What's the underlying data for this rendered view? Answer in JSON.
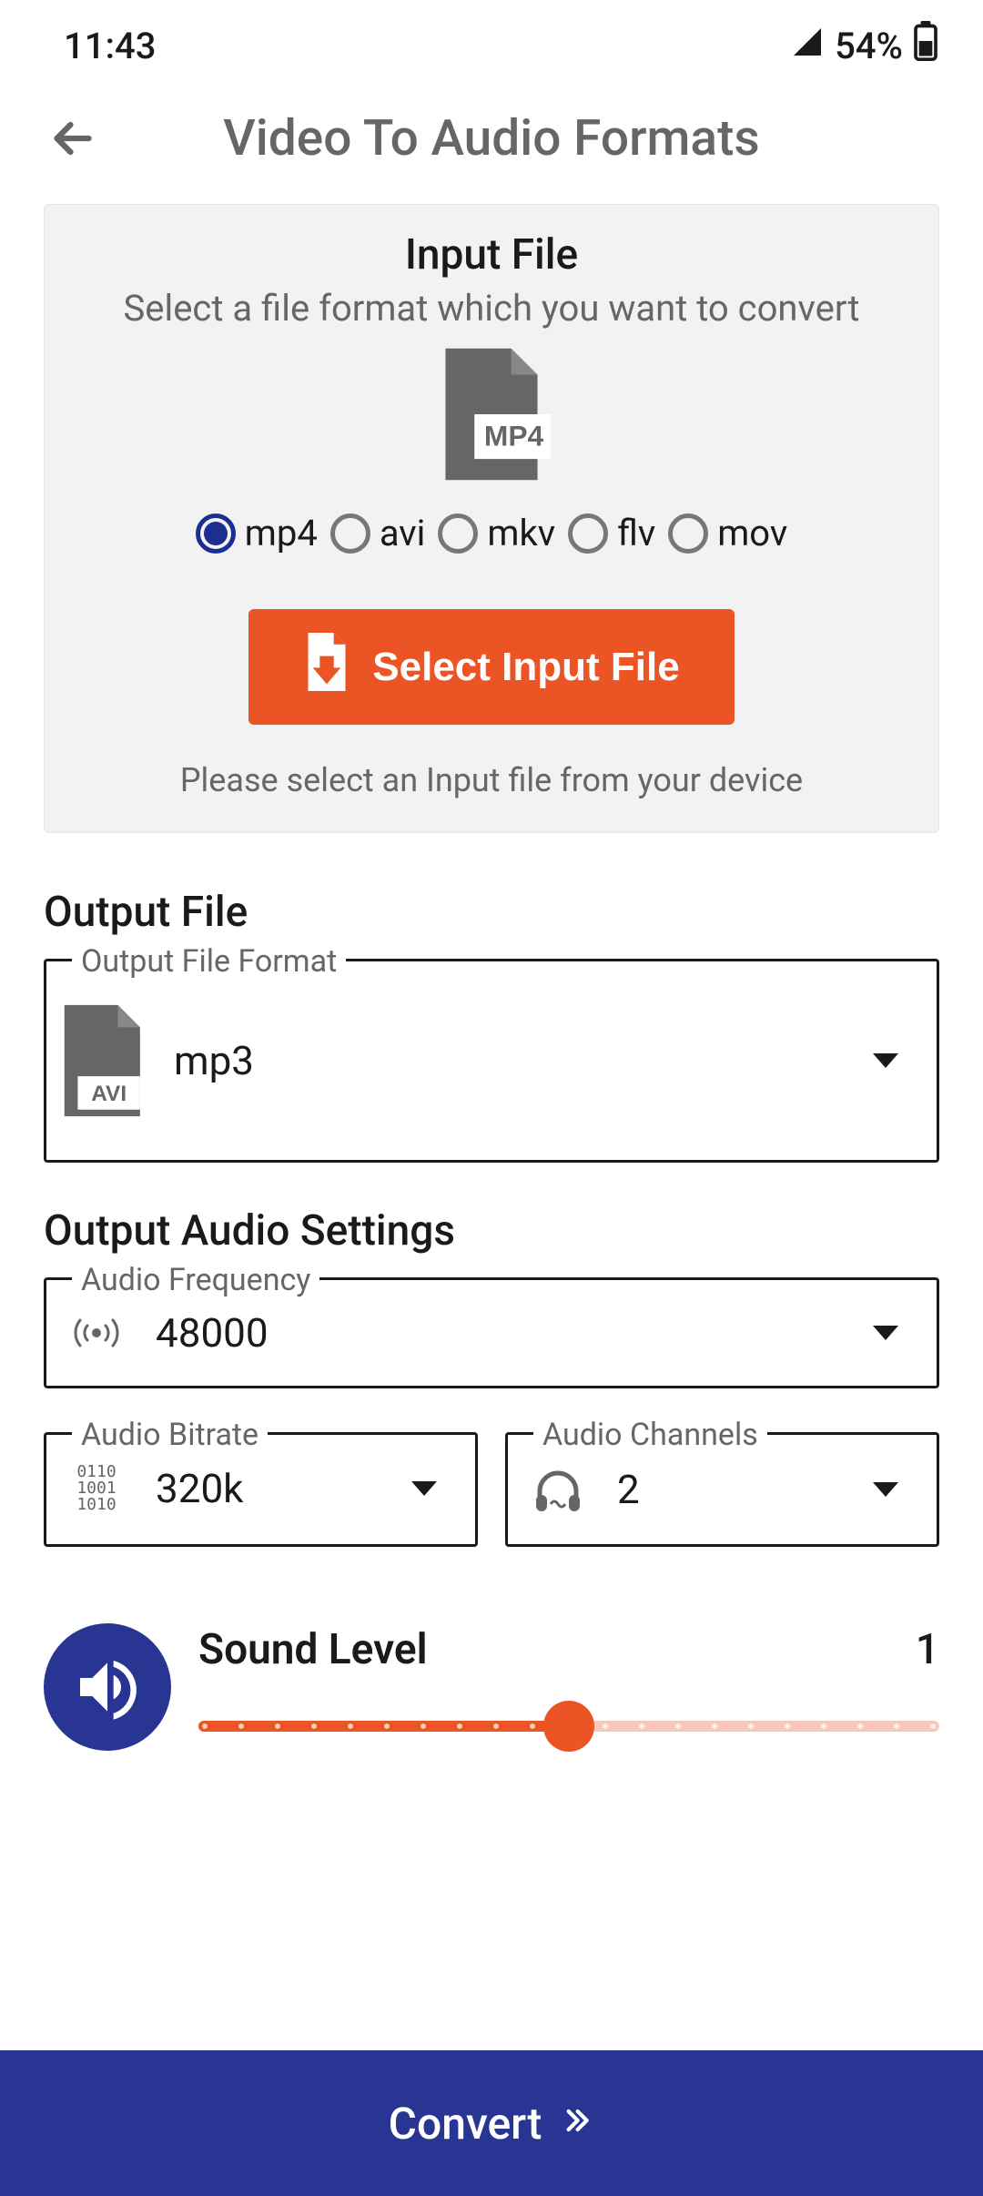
{
  "status": {
    "time": "11:43",
    "battery_pct": "54%"
  },
  "header": {
    "title": "Video To Audio Formats"
  },
  "input_card": {
    "title": "Input File",
    "subtitle": "Select a file format which you want to convert",
    "file_badge": "MP4",
    "formats": [
      "mp4",
      "avi",
      "mkv",
      "flv",
      "mov"
    ],
    "selected_format": "mp4",
    "button_label": "Select Input File",
    "hint": "Please select an Input file from your device"
  },
  "output": {
    "section_title": "Output File",
    "format": {
      "legend": "Output File Format",
      "icon_badge": "AVI",
      "value": "mp3"
    }
  },
  "audio_settings": {
    "section_title": "Output Audio Settings",
    "frequency": {
      "legend": "Audio Frequency",
      "value": "48000"
    },
    "bitrate": {
      "legend": "Audio Bitrate",
      "value": "320k"
    },
    "channels": {
      "legend": "Audio Channels",
      "value": "2"
    }
  },
  "sound": {
    "title": "Sound Level",
    "value": "1",
    "fraction": 0.5
  },
  "bottom": {
    "label": "Convert"
  },
  "colors": {
    "accent_orange": "#eb5424",
    "accent_navy": "#283593"
  }
}
